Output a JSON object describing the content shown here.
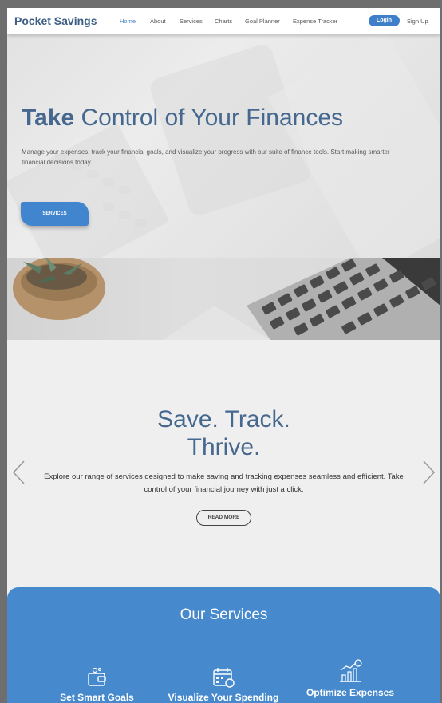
{
  "nav": {
    "brand": "Pocket Savings",
    "links": [
      "Home",
      "About",
      "Services",
      "Charts",
      "Goal Planner",
      "Expense Tracker"
    ],
    "login": "Login",
    "signup": "Sign Up"
  },
  "hero": {
    "title_bold": "Take",
    "title_rest": " Control of Your Finances",
    "description": "Manage your expenses, track your financial goals, and visualize your progress with our suite of finance tools. Start making smarter financial decisions today.",
    "button": "SERVICES"
  },
  "carousel": {
    "title_line1": "Save. Track.",
    "title_line2": "Thrive.",
    "description": "Explore our range of services designed to make saving and tracking expenses seamless and efficient. Take control of your financial journey with just a click.",
    "button": "READ MORE",
    "prev_icon": "chevron-left-icon",
    "next_icon": "chevron-right-icon"
  },
  "services": {
    "title": "Our Services",
    "items": [
      {
        "label": "Set Smart Goals",
        "icon": "wallet-icon"
      },
      {
        "label": "Visualize Your Spending",
        "icon": "calendar-money-icon"
      },
      {
        "label": "Optimize Expenses",
        "icon": "chart-growth-icon"
      }
    ]
  },
  "colors": {
    "brand": "#3d5f86",
    "accent": "#4285cf",
    "services_bg": "#4689cc"
  }
}
